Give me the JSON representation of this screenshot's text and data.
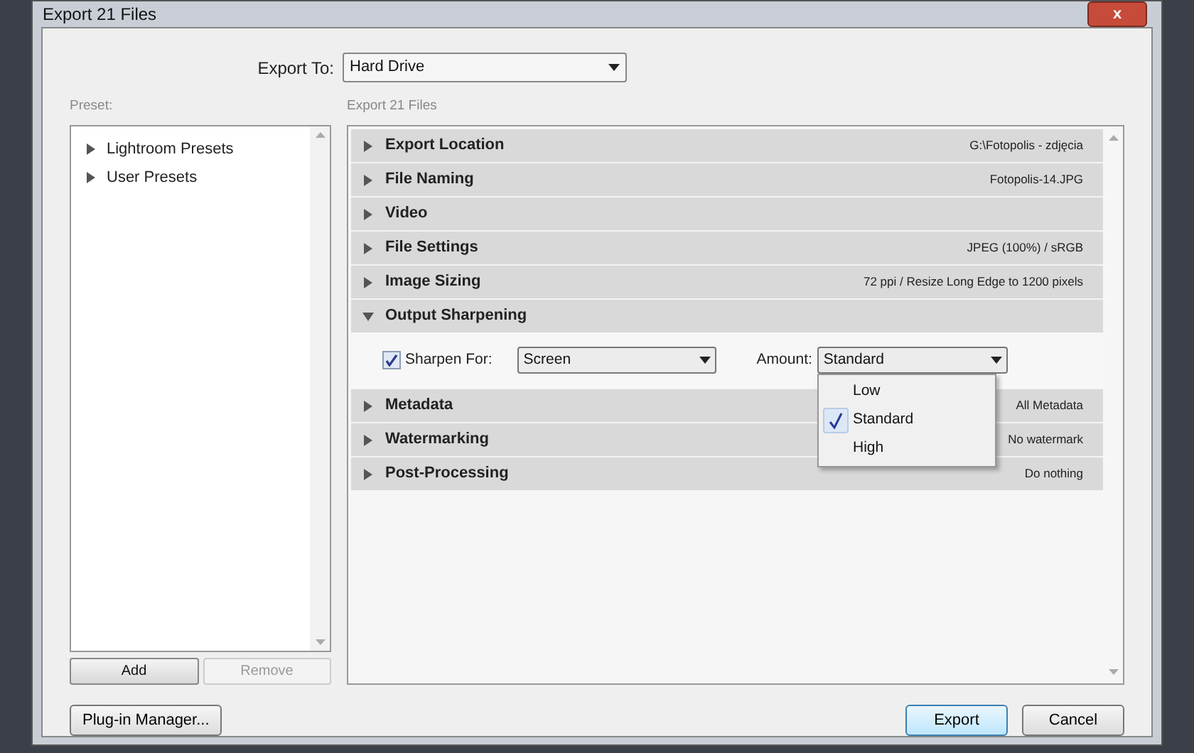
{
  "window": {
    "title": "Export 21 Files",
    "close": "x"
  },
  "export_to": {
    "label": "Export To:",
    "value": "Hard Drive"
  },
  "preset": {
    "label": "Preset:",
    "items": [
      {
        "label": "Lightroom Presets",
        "expanded": false
      },
      {
        "label": "User Presets",
        "expanded": false
      }
    ],
    "buttons": [
      {
        "label": "Add",
        "disabled": false
      },
      {
        "label": "Remove",
        "disabled": true
      }
    ]
  },
  "panel": {
    "heading": "Export 21 Files",
    "sections": [
      {
        "title": "Export Location",
        "summary": "G:\\Fotopolis - zdjęcia",
        "expanded": false
      },
      {
        "title": "File Naming",
        "summary": "Fotopolis-14.JPG",
        "expanded": false
      },
      {
        "title": "Video",
        "expanded": false
      },
      {
        "title": "File Settings",
        "summary": "JPEG (100%) / sRGB",
        "expanded": false
      },
      {
        "title": "Image Sizing",
        "summary": "72 ppi / Resize Long Edge to 1200 pixels",
        "expanded": false
      },
      {
        "title": "Output Sharpening",
        "expanded": true
      },
      {
        "title": "Metadata",
        "summary": "All Metadata",
        "expanded": false
      },
      {
        "title": "Watermarking",
        "summary": "No watermark",
        "expanded": false
      },
      {
        "title": "Post-Processing",
        "summary": "Do nothing",
        "expanded": false
      }
    ]
  },
  "sharpening": {
    "checkbox_label": "Sharpen For:",
    "checked": true,
    "sharpen_for": "Screen",
    "amount_label": "Amount:",
    "amount": "Standard",
    "menu": [
      {
        "label": "Low",
        "selected": false
      },
      {
        "label": "Standard",
        "selected": true
      },
      {
        "label": "High",
        "selected": false
      }
    ]
  },
  "footer": {
    "plugin_button": "Plug-in Manager...",
    "export_button": "Export",
    "cancel_button": "Cancel"
  }
}
